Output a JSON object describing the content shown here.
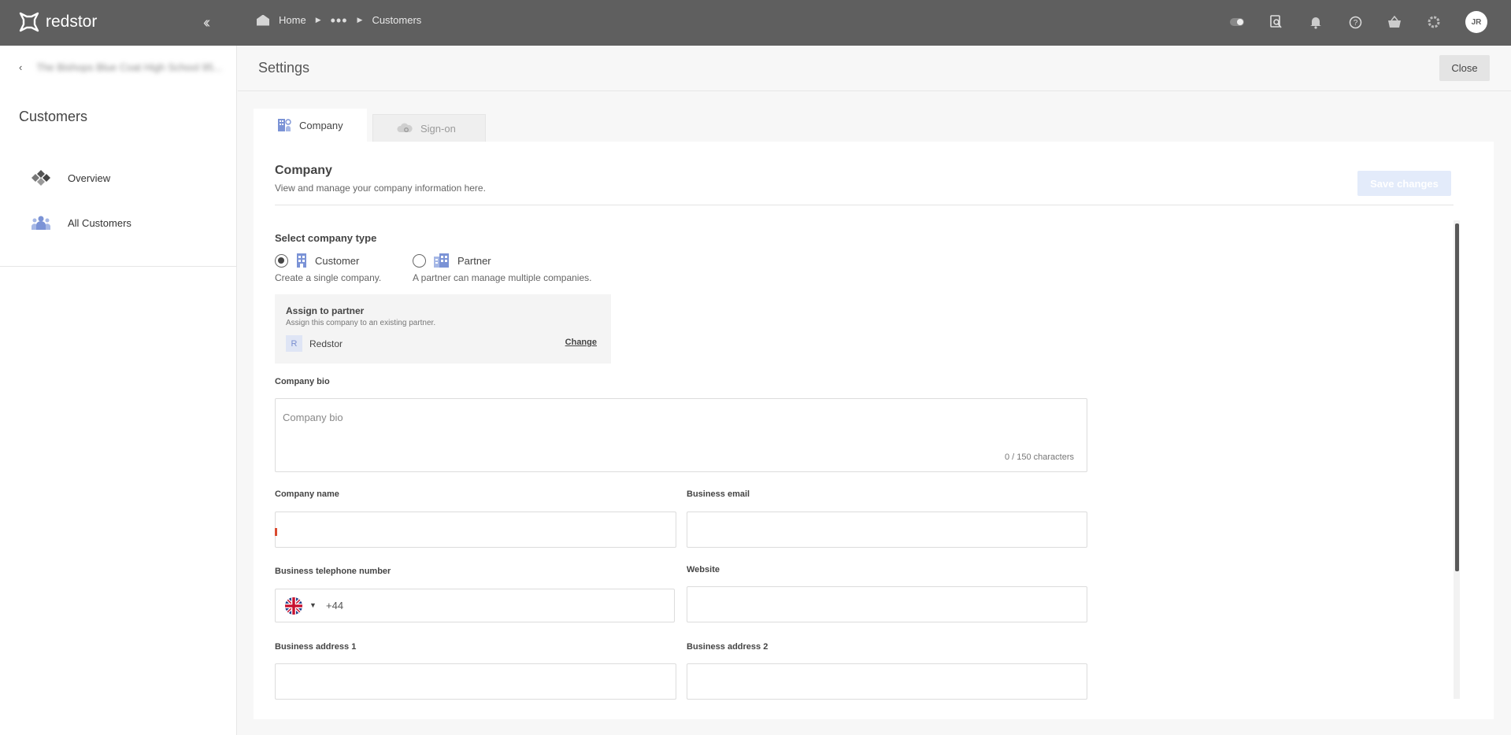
{
  "topbar": {
    "brand": "redstor",
    "breadcrumb": [
      "Home",
      "•••",
      "Customers"
    ],
    "avatar_initials": "JR"
  },
  "sidebar": {
    "back_label": "The Bishops Blue Coat High School 95...",
    "title": "Customers",
    "items": [
      {
        "label": "Overview"
      },
      {
        "label": "All Customers"
      }
    ]
  },
  "settings": {
    "title": "Settings",
    "close_label": "Close",
    "tabs": [
      {
        "label": "Company",
        "active": true
      },
      {
        "label": "Sign-on",
        "active": false
      }
    ]
  },
  "company": {
    "title": "Company",
    "subtitle": "View and manage your company information here.",
    "save_label": "Save changes",
    "type_label": "Select company type",
    "types": [
      {
        "label": "Customer",
        "desc": "Create a single company.",
        "selected": true
      },
      {
        "label": "Partner",
        "desc": "A partner can manage multiple companies.",
        "selected": false
      }
    ],
    "partner": {
      "title": "Assign to partner",
      "subtitle": "Assign this company to an existing partner.",
      "badge": "R",
      "name": "Redstor",
      "change_label": "Change"
    },
    "bio": {
      "label": "Company bio",
      "placeholder": "Company bio",
      "count": "0 / 150 characters"
    },
    "fields": {
      "company_name": "Company name",
      "business_email": "Business email",
      "telephone": "Business telephone number",
      "telephone_prefix": "+44",
      "website": "Website",
      "address1": "Business address 1",
      "address2": "Business address 2"
    }
  },
  "colors": {
    "topbar": "#5f5f5f",
    "accent_icon": "#7b93d6",
    "save_disabled": "#e3ebfa"
  }
}
